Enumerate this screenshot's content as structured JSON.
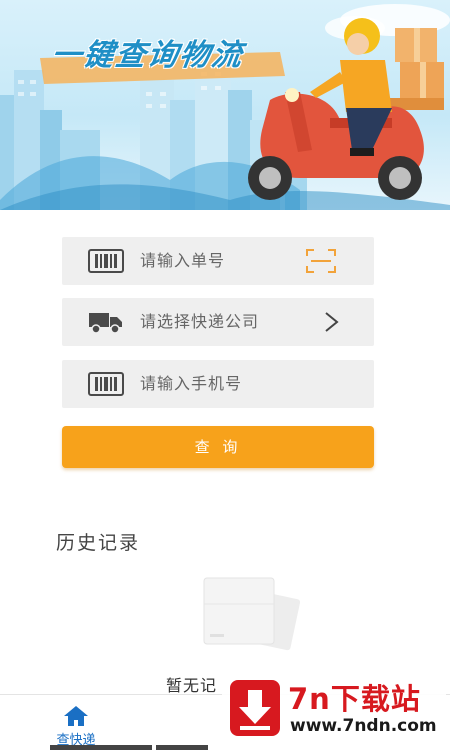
{
  "banner": {
    "title": "一键查询物流"
  },
  "form": {
    "tracking_number_placeholder": "请输入单号",
    "company_placeholder": "请选择快递公司",
    "phone_placeholder": "请输入手机号",
    "query_button_label": "查 询"
  },
  "history": {
    "title": "历史记录",
    "empty_text": "暂无记"
  },
  "nav": {
    "items": [
      {
        "label": "查快递",
        "icon": "home-icon",
        "active": true
      }
    ]
  },
  "watermark": {
    "brand": "7n下载站",
    "url": "www.7ndn.com"
  },
  "colors": {
    "accent": "#f7a21b",
    "nav_active": "#1a6fc4",
    "field_bg": "#efefef",
    "watermark_red": "#d7191f"
  }
}
